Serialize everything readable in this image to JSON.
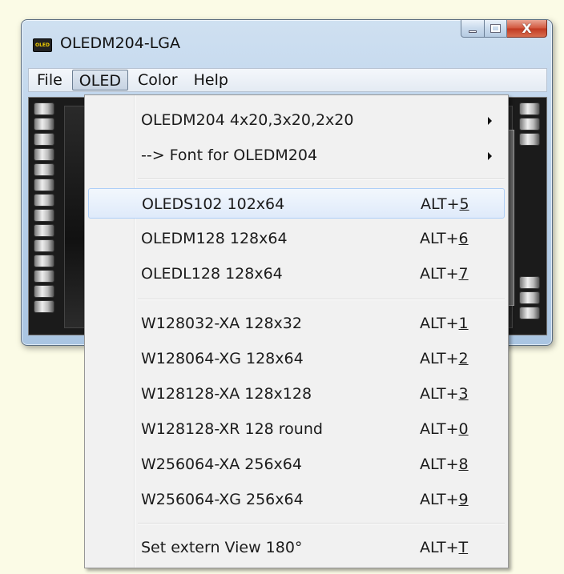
{
  "window": {
    "title": "OLEDM204-LGA",
    "icon_text": "OLED",
    "icon": "app-oled-icon",
    "caption_buttons": [
      "minimize-icon",
      "maximize-icon",
      "close-icon"
    ],
    "close_glyph": "X"
  },
  "menubar": {
    "items": [
      {
        "label": "File"
      },
      {
        "label": "OLED",
        "open": true
      },
      {
        "label": "Color"
      },
      {
        "label": "Help"
      }
    ]
  },
  "dropdown": {
    "items": [
      {
        "label": "OLEDM204  4x20,3x20,2x20",
        "submenu": true
      },
      {
        "label": "--> Font for OLEDM204",
        "submenu": true
      },
      {
        "label": "OLEDS102  102x64",
        "accel_prefix": "ALT+",
        "accel_key": "5",
        "highlighted": true
      },
      {
        "label": "OLEDM128  128x64",
        "accel_prefix": "ALT+",
        "accel_key": "6"
      },
      {
        "label": "OLEDL128  128x64",
        "accel_prefix": "ALT+",
        "accel_key": "7"
      },
      {
        "label": "W128032-XA  128x32",
        "accel_prefix": "ALT+",
        "accel_key": "1"
      },
      {
        "label": "W128064-XG  128x64",
        "accel_prefix": "ALT+",
        "accel_key": "2"
      },
      {
        "label": "W128128-XA  128x128",
        "accel_prefix": "ALT+",
        "accel_key": "3"
      },
      {
        "label": "W128128-XR  128 round",
        "accel_prefix": "ALT+",
        "accel_key": "0"
      },
      {
        "label": "W256064-XA  256x64",
        "accel_prefix": "ALT+",
        "accel_key": "8"
      },
      {
        "label": "W256064-XG  256x64",
        "accel_prefix": "ALT+",
        "accel_key": "9"
      },
      {
        "label": "Set extern View 180°",
        "accel_prefix": "ALT+",
        "accel_key": "T"
      }
    ]
  },
  "colors": {
    "page_background": "#fbfbe6",
    "highlight_border": "#aecff7",
    "close_button": "#c13a22"
  }
}
